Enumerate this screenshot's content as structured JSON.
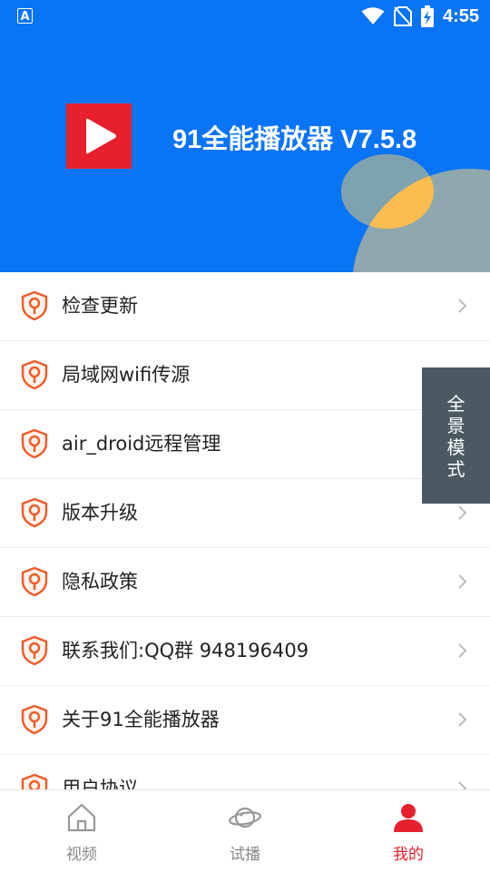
{
  "status_bar": {
    "left_icon": "A",
    "time": "4:55",
    "icons": [
      "wifi-icon",
      "no-sim-icon",
      "battery-charging-icon"
    ]
  },
  "header": {
    "app_title": "91全能播放器 V7.5.8",
    "logo_icon": "play-icon",
    "colors": {
      "background": "#0A74F6",
      "logo": "#E6202D",
      "accent_circle": "#FDBC4F",
      "grey_circle": "#8FA8AE"
    }
  },
  "menu": {
    "items": [
      {
        "label": "检查更新"
      },
      {
        "label": "局域网wifi传源"
      },
      {
        "label": "air_droid远程管理"
      },
      {
        "label": "版本升级"
      },
      {
        "label": "隐私政策"
      },
      {
        "label": "联系我们:QQ群 948196409"
      },
      {
        "label": "关于91全能播放器"
      },
      {
        "label": "用户协议"
      }
    ],
    "icon": "shield-key-icon",
    "chevron": "chevron-right-icon"
  },
  "floating_button": {
    "label_chars": [
      "全",
      "景",
      "模",
      "式"
    ]
  },
  "tabbar": {
    "tabs": [
      {
        "label": "视频",
        "icon": "home-icon",
        "active": false
      },
      {
        "label": "试播",
        "icon": "planet-icon",
        "active": false
      },
      {
        "label": "我的",
        "icon": "user-icon",
        "active": true
      }
    ],
    "active_color": "#E6202D",
    "inactive_color": "#888888"
  }
}
